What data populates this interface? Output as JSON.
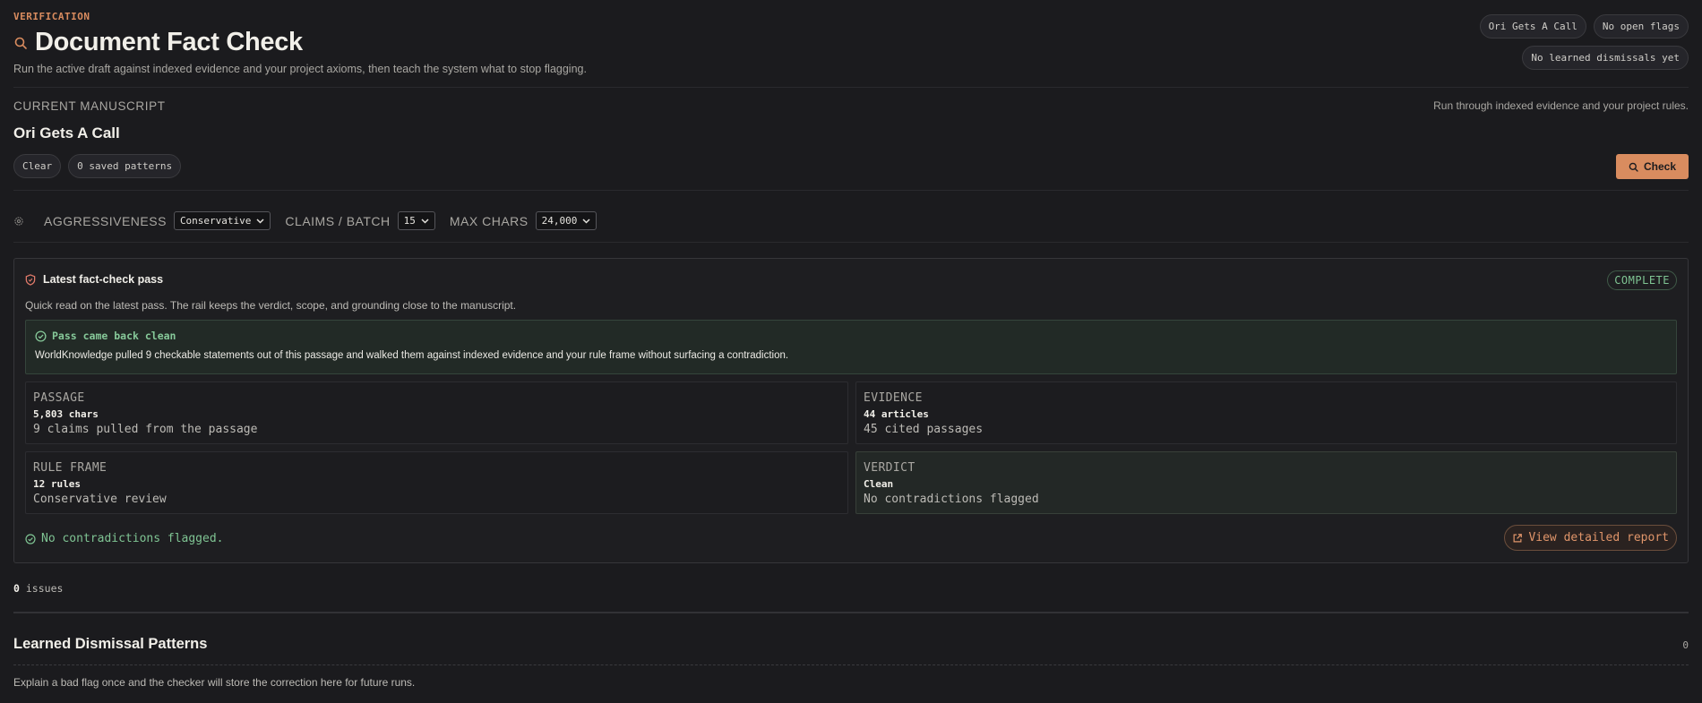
{
  "header": {
    "eyebrow": "VERIFICATION",
    "title": "Document Fact Check",
    "subtitle": "Run the active draft against indexed evidence and your project axioms, then teach the system what to stop flagging.",
    "pills": [
      "Ori Gets A Call",
      "No open flags",
      "No learned dismissals yet"
    ]
  },
  "manuscript": {
    "label": "CURRENT MANUSCRIPT",
    "note": "Run through indexed evidence and your project rules.",
    "title": "Ori Gets A Call",
    "clear_label": "Clear",
    "patterns_label": "0 saved patterns",
    "check_label": "Check"
  },
  "settings": {
    "aggressiveness_label": "AGGRESSIVENESS",
    "aggressiveness_value": "Conservative",
    "claims_label": "CLAIMS / BATCH",
    "claims_value": "15",
    "maxchars_label": "MAX CHARS",
    "maxchars_value": "24,000"
  },
  "pass": {
    "title": "Latest fact-check pass",
    "status": "COMPLETE",
    "description": "Quick read on the latest pass. The rail keeps the verdict, scope, and grounding close to the manuscript.",
    "banner_title": "Pass came back clean",
    "banner_text": "WorldKnowledge pulled 9 checkable statements out of this passage and walked them against indexed evidence and your rule frame without surfacing a contradiction.",
    "stats": [
      {
        "key": "PASSAGE",
        "value": "5,803 chars",
        "detail": "9 claims pulled from the passage"
      },
      {
        "key": "EVIDENCE",
        "value": "44 articles",
        "detail": "45 cited passages"
      },
      {
        "key": "RULE FRAME",
        "value": "12 rules",
        "detail": "Conservative review"
      },
      {
        "key": "VERDICT",
        "value": "Clean",
        "detail": "No contradictions flagged"
      }
    ],
    "result_text": "No contradictions flagged.",
    "report_label": "View detailed report"
  },
  "issues": {
    "count": "0",
    "label": "issues"
  },
  "learned": {
    "title": "Learned Dismissal Patterns",
    "count": "0",
    "description": "Explain a bad flag once and the checker will store the correction here for future runs."
  },
  "colors": {
    "accent": "#d98c5f",
    "success": "#7fc493",
    "background": "#1b1b1e"
  }
}
